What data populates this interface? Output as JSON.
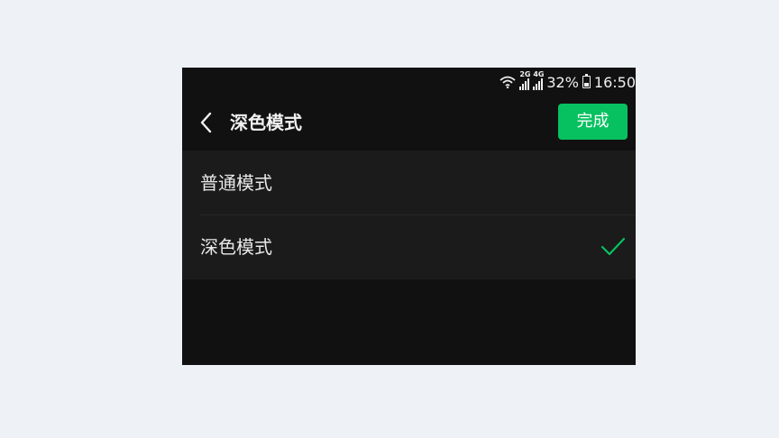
{
  "status_bar": {
    "net_a": "2G",
    "net_b": "4G",
    "battery": "32%",
    "time": "16:50",
    "icons": [
      "wifi-icon",
      "signal-icon",
      "signal-icon",
      "battery-icon"
    ]
  },
  "header": {
    "back_icon": "chevron-left-icon",
    "title": "深色模式",
    "done_label": "完成"
  },
  "options": [
    {
      "label": "普通模式",
      "selected": false
    },
    {
      "label": "深色模式",
      "selected": true
    }
  ],
  "colors": {
    "accent": "#07c160",
    "background": "#111111",
    "list_background": "#1b1b1b",
    "page_background": "#eef2f6"
  }
}
